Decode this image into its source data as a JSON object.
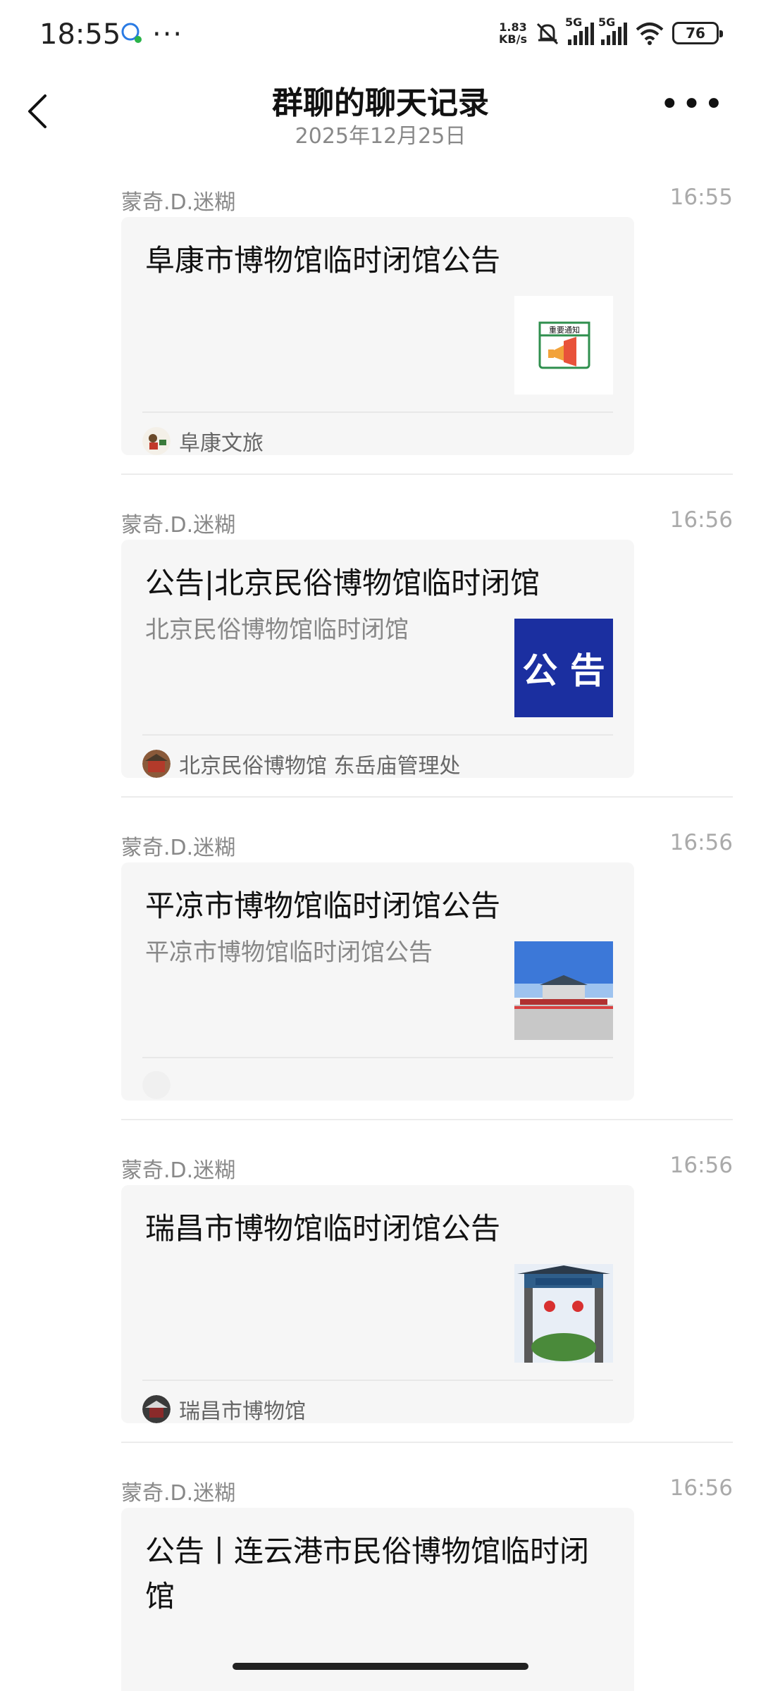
{
  "status": {
    "time": "18:55",
    "net_speed_value": "1.83",
    "net_speed_unit": "KB/s",
    "sim1": "5G",
    "sim2": "5G",
    "battery": "76"
  },
  "header": {
    "title": "群聊的聊天记录",
    "date": "2025年12月25日"
  },
  "messages": [
    {
      "sender": "蒙奇.D.迷糊",
      "time": "16:55",
      "title": "阜康市博物馆临时闭馆公告",
      "desc": "",
      "thumb_text": "重要通知",
      "source": "阜康文旅"
    },
    {
      "sender": "蒙奇.D.迷糊",
      "time": "16:56",
      "title": "公告|北京民俗博物馆临时闭馆",
      "desc": "北京民俗博物馆临时闭馆",
      "thumb_text": "公 告",
      "source": "北京民俗博物馆 东岳庙管理处"
    },
    {
      "sender": "蒙奇.D.迷糊",
      "time": "16:56",
      "title": "平凉市博物馆临时闭馆公告",
      "desc": "平凉市博物馆临时闭馆公告",
      "thumb_text": "",
      "source": ""
    },
    {
      "sender": "蒙奇.D.迷糊",
      "time": "16:56",
      "title": "瑞昌市博物馆临时闭馆公告",
      "desc": "",
      "thumb_text": "",
      "source": "瑞昌市博物馆"
    },
    {
      "sender": "蒙奇.D.迷糊",
      "time": "16:56",
      "title": "公告丨连云港市民俗博物馆临时闭馆",
      "desc": "",
      "thumb_text": "",
      "source": ""
    }
  ],
  "colors": {
    "card_bg": "#f6f6f6",
    "muted_text": "#888888",
    "announcement_blue": "#1b2fa0"
  }
}
